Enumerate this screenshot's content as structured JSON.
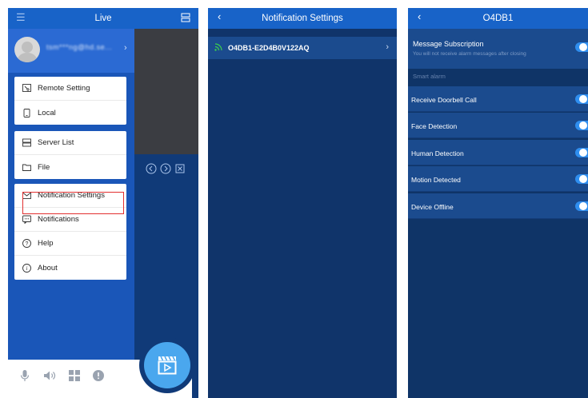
{
  "panel1": {
    "header_title": "Live",
    "username": "tsm***ng@hd.se...",
    "menu_group1": [
      {
        "label": "Remote Setting",
        "icon": "remote-setting-icon"
      },
      {
        "label": "Local",
        "icon": "phone-icon"
      }
    ],
    "menu_group2": [
      {
        "label": "Server List",
        "icon": "server-list-icon"
      },
      {
        "label": "File",
        "icon": "folder-icon"
      }
    ],
    "menu_group3": [
      {
        "label": "Notification Settings",
        "icon": "notification-settings-icon"
      },
      {
        "label": "Notifications",
        "icon": "notifications-icon"
      },
      {
        "label": "Help",
        "icon": "help-icon"
      },
      {
        "label": "About",
        "icon": "info-icon"
      }
    ],
    "highlighted_item": "Notification Settings"
  },
  "panel2": {
    "header_title": "Notification Settings",
    "device_name": "O4DB1-E2D4B0V122AQ"
  },
  "panel3": {
    "header_title": "O4DB1",
    "subscription_title": "Message Subscription",
    "subscription_hint": "You will not receive alarm messages after closing",
    "section_title": "Smart alarm",
    "rows": [
      {
        "label": "Receive Doorbell Call",
        "enabled": true
      },
      {
        "label": "Face Detection",
        "enabled": true
      },
      {
        "label": "Human Detection",
        "enabled": true
      },
      {
        "label": "Motion Detected",
        "enabled": true
      },
      {
        "label": "Device Offline",
        "enabled": true
      }
    ]
  },
  "colors": {
    "header": "#1863c8",
    "panel_bg": "#10346a",
    "row_bg": "#1b4b8e",
    "toggle_on": "#2f8eef",
    "highlight": "#e23030",
    "fab": "#4aa7ee"
  }
}
